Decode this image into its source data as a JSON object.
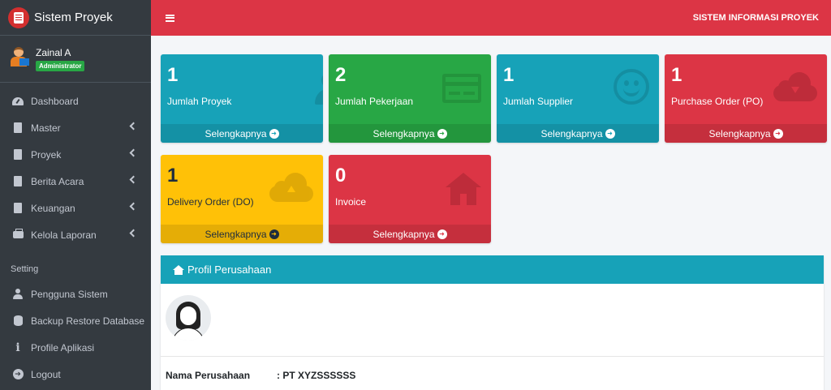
{
  "brand": {
    "title": "Sistem Proyek"
  },
  "user": {
    "name": "Zainal A",
    "role": "Administrator"
  },
  "sidebar": {
    "items": [
      {
        "label": "Dashboard"
      },
      {
        "label": "Master"
      },
      {
        "label": "Proyek"
      },
      {
        "label": "Berita Acara"
      },
      {
        "label": "Keuangan"
      },
      {
        "label": "Kelola Laporan"
      }
    ],
    "setting_header": "Setting",
    "setting_items": [
      {
        "label": "Pengguna Sistem"
      },
      {
        "label": "Backup Restore Database"
      },
      {
        "label": "Profile Aplikasi"
      },
      {
        "label": "Logout"
      }
    ]
  },
  "header": {
    "app_title": "SISTEM INFORMASI PROYEK"
  },
  "boxes": [
    {
      "value": "1",
      "label": "Jumlah Proyek",
      "more": "Selengkapnya",
      "color": "#17a2b8",
      "icon": "user-plus-icon"
    },
    {
      "value": "2",
      "label": "Jumlah Pekerjaan",
      "more": "Selengkapnya",
      "color": "#28a745",
      "icon": "credit-card-icon"
    },
    {
      "value": "1",
      "label": "Jumlah Supplier",
      "more": "Selengkapnya",
      "color": "#17a2b8",
      "icon": "smile-icon"
    },
    {
      "value": "1",
      "label": "Purchase Order (PO)",
      "more": "Selengkapnya",
      "color": "#dc3545",
      "icon": "cloud-download-icon"
    },
    {
      "value": "1",
      "label": "Delivery Order (DO)",
      "more": "Selengkapnya",
      "color": "#ffc107",
      "icon": "cloud-upload-icon"
    },
    {
      "value": "0",
      "label": "Invoice",
      "more": "Selengkapnya",
      "color": "#dc3545",
      "icon": "home-icon"
    }
  ],
  "profile": {
    "title": "Profil Perusahaan",
    "company_label": "Nama Perusahaan",
    "company_value": ": PT XYZSSSSSS"
  }
}
